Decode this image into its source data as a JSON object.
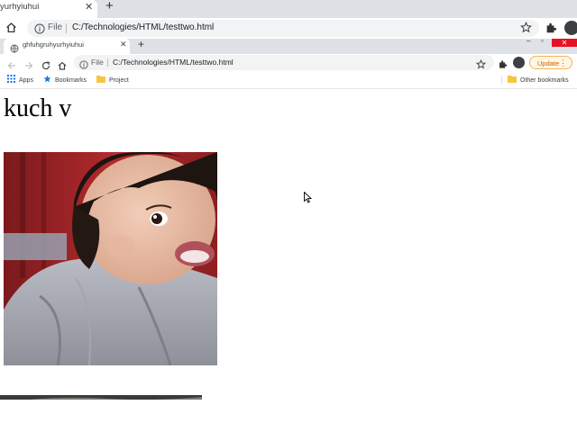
{
  "outer_browser": {
    "tab_title": "yurhyiuhui",
    "address": {
      "scheme": "File",
      "url": "C:/Technologies/HTML/testtwo.html"
    }
  },
  "inner_browser": {
    "tab_title": "ghfuhgruhyurhyiuhui",
    "address": {
      "scheme": "File",
      "url": "C:/Technologies/HTML/testtwo.html"
    },
    "update_button": "Update",
    "bookmarks": [
      {
        "label": "Apps",
        "icon": "apps-grid-icon"
      },
      {
        "label": "Bookmarks",
        "icon": "star-icon"
      },
      {
        "label": "Project",
        "icon": "folder-icon"
      }
    ],
    "other_bookmarks": "Other bookmarks"
  },
  "page": {
    "heading": "kuch v",
    "image": "photo of a young child in a grey hooded jacket against a red background"
  },
  "colors": {
    "tabstrip": "#dee1e6",
    "omnibox": "#f1f3f4",
    "update_accent": "#f0b45a",
    "close_red": "#e81123",
    "bookmark_star": "#1a73e8",
    "folder": "#f6c544"
  }
}
